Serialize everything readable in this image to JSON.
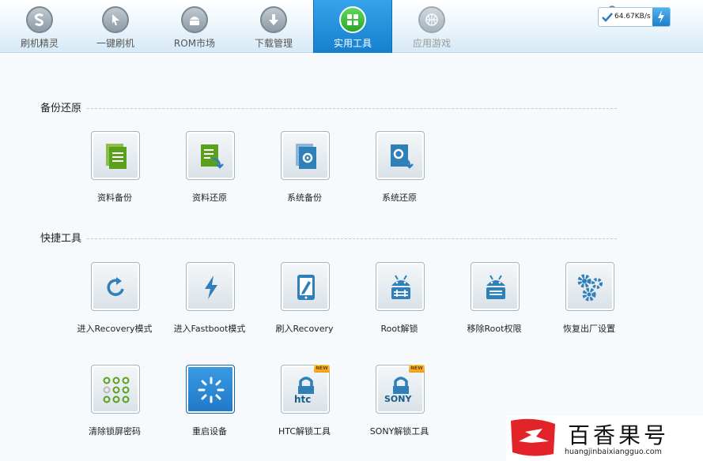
{
  "tabs": [
    {
      "label": "刷机精灵",
      "icon": "s-logo-icon"
    },
    {
      "label": "一键刷机",
      "icon": "cursor-icon"
    },
    {
      "label": "ROM市场",
      "icon": "android-icon"
    },
    {
      "label": "下载管理",
      "icon": "download-icon"
    },
    {
      "label": "实用工具",
      "icon": "grid-icon",
      "active": true
    },
    {
      "label": "应用游戏",
      "icon": "basketball-icon"
    }
  ],
  "speed": {
    "value": "64.67KB/s",
    "icon": "lightning-icon"
  },
  "sections": {
    "backup": {
      "title": "备份还原",
      "items": [
        {
          "label": "资料备份",
          "icon": "document-backup-icon"
        },
        {
          "label": "资料还原",
          "icon": "document-restore-icon"
        },
        {
          "label": "系统备份",
          "icon": "system-backup-icon"
        },
        {
          "label": "系统还原",
          "icon": "system-restore-icon"
        }
      ]
    },
    "quick": {
      "title": "快捷工具",
      "items": [
        {
          "label": "进入Recovery模式",
          "icon": "refresh-icon"
        },
        {
          "label": "进入Fastboot模式",
          "icon": "lightning-icon"
        },
        {
          "label": "刷入Recovery",
          "icon": "phone-edit-icon"
        },
        {
          "label": "Root解锁",
          "icon": "android-unlock-icon"
        },
        {
          "label": "移除Root权限",
          "icon": "android-remove-icon"
        },
        {
          "label": "恢复出厂设置",
          "icon": "gears-icon"
        },
        {
          "label": "清除锁屏密码",
          "icon": "pattern-lock-icon"
        },
        {
          "label": "重启设备",
          "icon": "loading-icon"
        },
        {
          "label": "HTC解锁工具",
          "icon": "htc-lock-icon",
          "badge": "NEW",
          "brand": "htc"
        },
        {
          "label": "SONY解锁工具",
          "icon": "sony-lock-icon",
          "badge": "NEW",
          "brand": "SONY"
        }
      ]
    }
  },
  "watermark": {
    "name": "百香果号",
    "url": "huangjinbaixiangguo.com"
  },
  "colors": {
    "accent": "#1d86d2",
    "green": "#5aa01c",
    "icon_blue": "#2f7fb8"
  }
}
